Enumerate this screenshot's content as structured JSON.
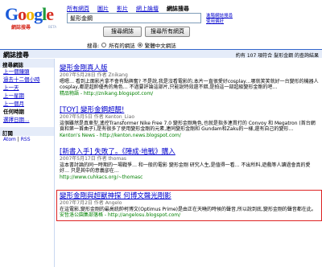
{
  "logo": {
    "sub_label": "網誌搜尋",
    "beta_label": "BETA"
  },
  "topnav": {
    "items": [
      "所有網頁",
      "圖片",
      "影片",
      "網上論壇",
      "網誌搜尋"
    ]
  },
  "search": {
    "value": "髮形金鋼"
  },
  "side_links": {
    "advanced": "進階網誌搜尋",
    "preferences": "使用偏好"
  },
  "buttons": {
    "search_blogs": "搜尋網誌",
    "search_web": "搜尋所有網頁"
  },
  "scope": {
    "label": "搜尋:",
    "option_all": "所有的網誌",
    "option_chinese": "繁體中文網誌"
  },
  "header": {
    "title": "網誌搜尋",
    "stats": "約有 107 項符合 髮形金鋼 的查詢結果"
  },
  "sidebar": {
    "title": "搜尋網誌",
    "items": [
      "上一個鐘頭",
      "過去十二個小時",
      "上一天",
      "上一星期",
      "上一個月",
      "任何時期",
      "選擇日期…"
    ],
    "feeds_label": "訂閱",
    "atom": "Atom",
    "rss": "RSS"
  },
  "results": [
    {
      "title": "變形金剛真人版",
      "meta": "2007年5月28日 作者 Znikang",
      "snippet": "嗯嗯… 看到上面影片拿不會有點興奮? 不是說,我是沒看電影的,本片一直很愛好cosplay…哪就笑笑就好一台變形的機器人cosplay,都是超帥優秀的角色… 不過要評論這部片,只能說特效還不錯,是拍這一部超級變形金剛的吧…",
      "url": "精品物語 - http://znikang.blogspot.com/"
    },
    {
      "title": "[TOY] 變形金鋼超靚!",
      "meta": "2007年5月5日 作者 Kenton_Liao",
      "snippet": "這個雖然是真車型,遙控Transformer Nike Free 7.0 變形金剛角色,也就是指多連貫打的 Convoy 和 Megatron (首台網頁和第一首曲子),是有很多了使用變形金剛的元素,連同變形金剛和 Gundam和Zaku的一樣,還有自己的變形…",
      "url": "Kenton's News - http://kenton.news.blogspot.com/"
    },
    {
      "title": "[新書入手] 失敗了。《陣成‧地戰》購入",
      "meta": "2007年5月17日 作者 thomas",
      "snippet": "這本書討論的同一時期的一場戰爭… 和一般的電影 變形金剛 研究人生,是值得一看… 不出所料,遊戲等人讀過會真的愛好… 只是其中的意義卻在…",
      "url": "http://www.cuhkacs.org/~thomasc"
    },
    {
      "title": "變形金剛與超獸神探 何博文聲光剛影",
      "meta": "2007年7月2日 作者 Angelo",
      "snippet": "在這電影,變形金剛的最高統帥柯博文(Optimus Prime)是由正在天曉的時候的聲音,所以說到底,變形金剛的聲音都在此。",
      "url": "安哲洛公園集部落格 - http://angelosu.blogspot.com/"
    }
  ]
}
